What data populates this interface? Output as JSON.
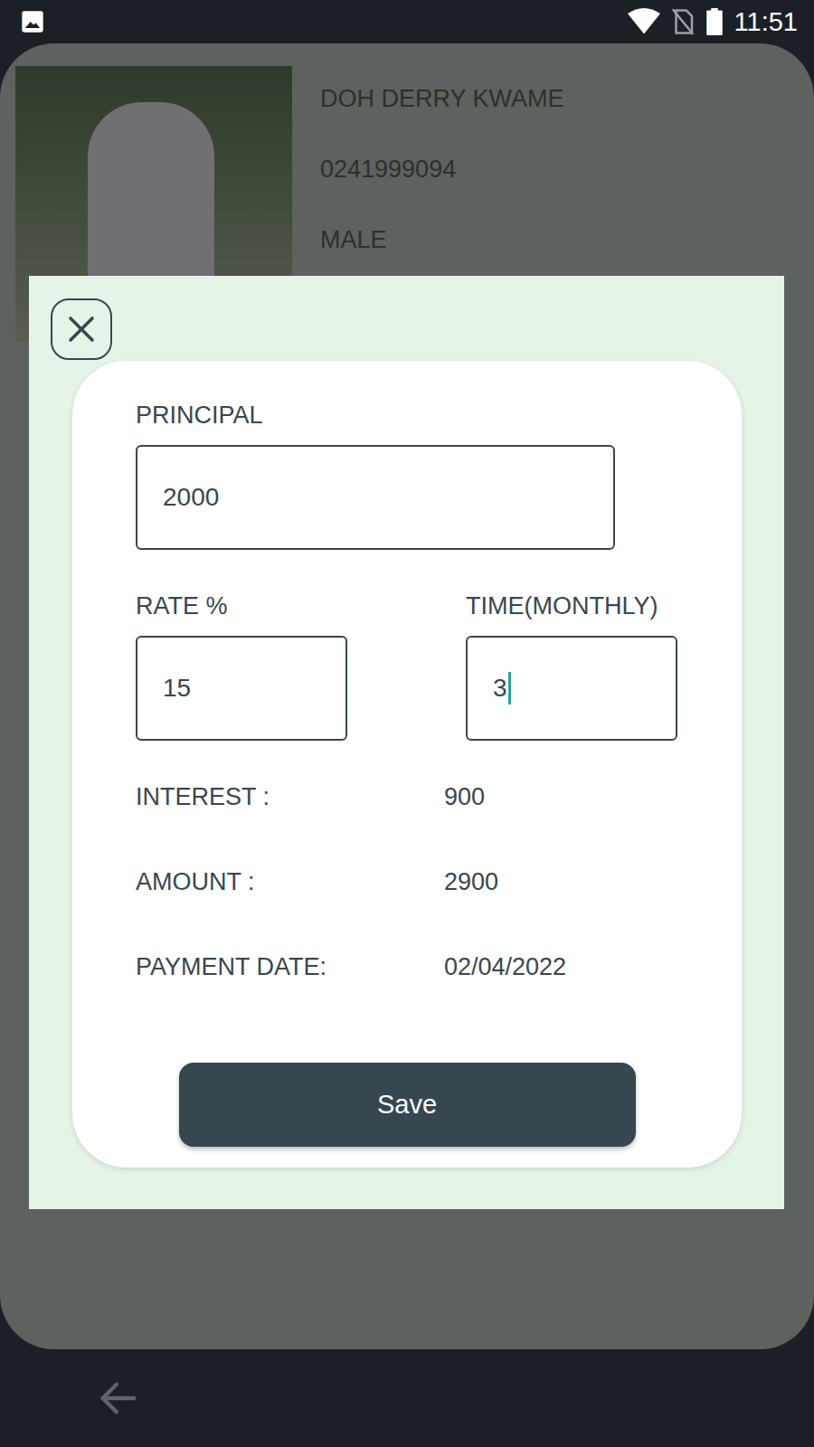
{
  "status_bar": {
    "time": "11:51"
  },
  "profile": {
    "name": "DOH DERRY KWAME",
    "phone": "0241999094",
    "gender": "MALE"
  },
  "fields": [
    {
      "label": "PRINCIPAL",
      "value": "2000",
      "focused": false
    },
    {
      "label": "RATE %",
      "value": "15",
      "focused": false
    },
    {
      "label": "TIME(MONTHLY)",
      "value": "3",
      "focused": true
    }
  ],
  "results": [
    {
      "label": "INTEREST :",
      "value": "900"
    },
    {
      "label": "AMOUNT :",
      "value": "2900"
    },
    {
      "label": "PAYMENT DATE:",
      "value": "02/04/2022"
    }
  ],
  "buttons": [
    "Save"
  ]
}
